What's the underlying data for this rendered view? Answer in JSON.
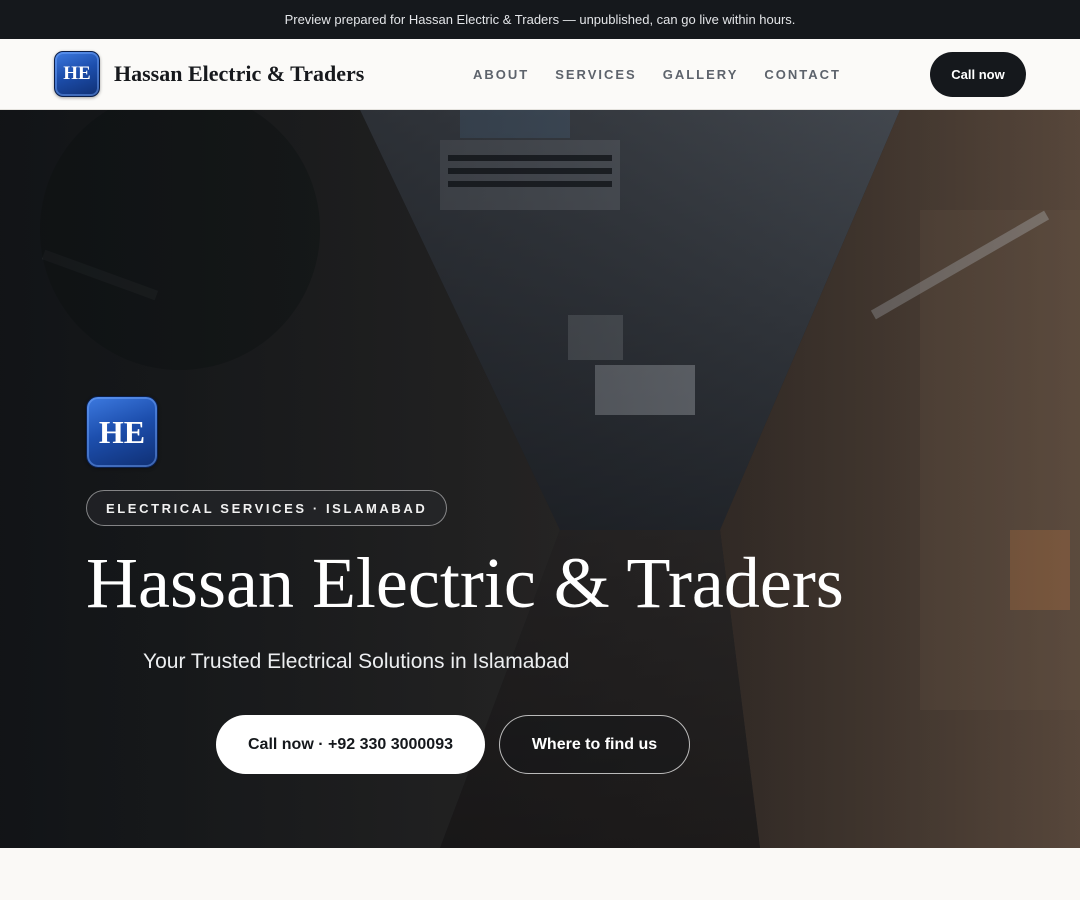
{
  "preview_banner": "Preview prepared for Hassan Electric & Traders — unpublished, can go live within hours.",
  "header": {
    "logo_text": "HE",
    "brand_name": "Hassan Electric & Traders",
    "nav": [
      {
        "label": "About"
      },
      {
        "label": "Services"
      },
      {
        "label": "Gallery"
      },
      {
        "label": "Contact"
      }
    ],
    "cta_label": "Call now"
  },
  "hero": {
    "logo_text": "HE",
    "eyebrow": "Electrical services · Islamabad",
    "title": "Hassan Electric & Traders",
    "subtitle": "Your Trusted Electrical Solutions in Islamabad",
    "primary_button": "Call now · +92 330 3000093",
    "secondary_button": "Where to find us"
  },
  "colors": {
    "dark": "#15181c",
    "logo_blue": "#1d4fae",
    "page_bg": "#faf9f6"
  }
}
